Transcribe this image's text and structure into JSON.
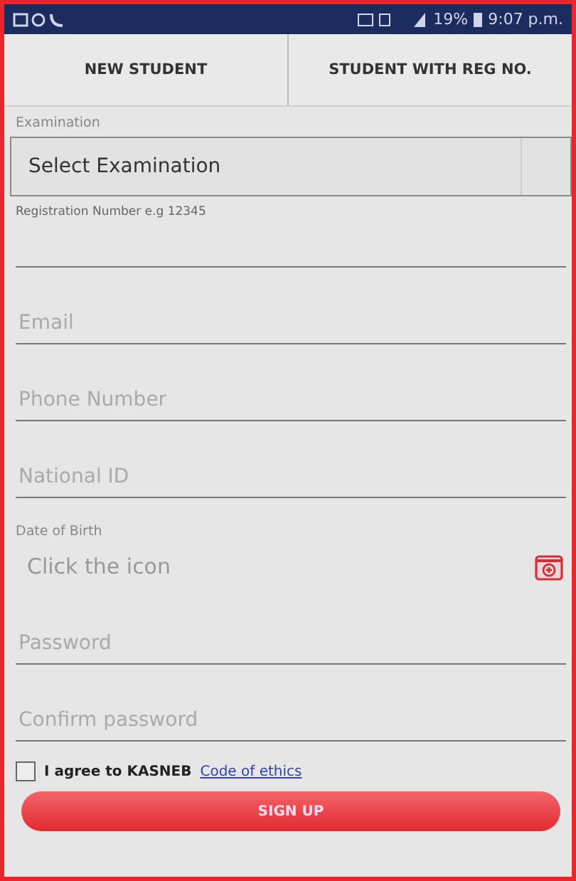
{
  "status_bar": {
    "battery": "19%",
    "time": "9:07 p.m."
  },
  "tabs": [
    {
      "label": "NEW STUDENT"
    },
    {
      "label": "STUDENT WITH REG NO."
    }
  ],
  "examination": {
    "label": "Examination",
    "value": "Select Examination"
  },
  "fields": [
    {
      "kind": "text",
      "label": "Registration Number e.g 12345"
    },
    {
      "kind": "text",
      "placeholder": "Email"
    },
    {
      "kind": "text",
      "placeholder": "Phone Number"
    },
    {
      "kind": "text",
      "placeholder": "National ID"
    },
    {
      "kind": "date",
      "label": "Date of Birth",
      "placeholder": "Click the icon"
    },
    {
      "kind": "text",
      "placeholder": "Password"
    },
    {
      "kind": "text",
      "placeholder": "Confirm password"
    }
  ],
  "agreement": {
    "checked": false,
    "text": "I agree to KASNEB",
    "link": "Code of ethics"
  },
  "submit": "SIGN UP"
}
